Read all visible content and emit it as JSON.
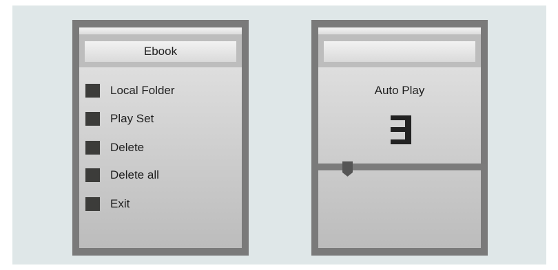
{
  "left_screen": {
    "header_title": "Ebook",
    "menu": [
      {
        "label": "Local Folder"
      },
      {
        "label": "Play Set"
      },
      {
        "label": "Delete"
      },
      {
        "label": "Delete all"
      },
      {
        "label": "Exit"
      }
    ]
  },
  "right_screen": {
    "header_title": "",
    "title": "Auto Play",
    "value_digit": "3",
    "slider_value_fraction": 0.16
  },
  "colors": {
    "background": "#dfe7e8",
    "frame": "#7a7a7a",
    "menu_box": "#3c3c3a"
  }
}
